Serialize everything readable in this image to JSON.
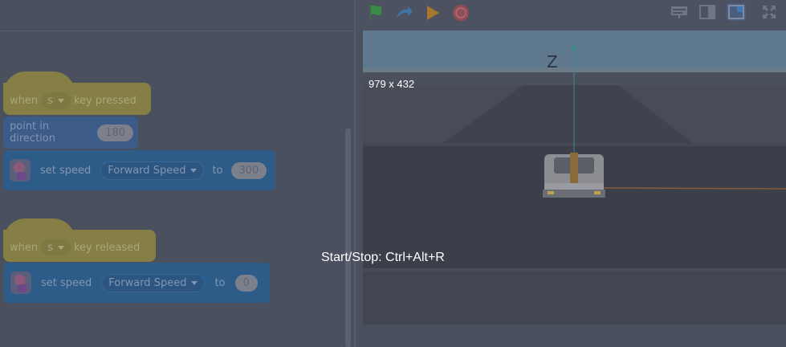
{
  "script": {
    "block1": {
      "hat_when": "when",
      "hat_key": "s",
      "hat_suffix": "key pressed",
      "point_label": "point in direction",
      "point_value": "180",
      "set_label": "set speed",
      "set_param": "Forward Speed",
      "set_to": "to",
      "set_value": "300"
    },
    "block2": {
      "hat_when": "when",
      "hat_key": "s",
      "hat_suffix": "key released",
      "set_label": "set speed",
      "set_param": "Forward Speed",
      "set_to": "to",
      "set_value": "0"
    }
  },
  "toolbar": {
    "icons": [
      "green-flag-icon",
      "turbo-arrow-icon",
      "play-icon",
      "stop-icon"
    ],
    "view_icons": [
      "presentation-icon",
      "small-stage-icon",
      "large-stage-icon",
      "fullscreen-icon"
    ]
  },
  "stage": {
    "axis_label": "Z",
    "size_label": "979 x 432"
  },
  "overlay": {
    "shortcut_text": "Start/Stop: Ctrl+Alt+R"
  },
  "colors": {
    "hat_block": "#857f45",
    "motion_block": "#3d5b88",
    "extension_block": "#2e5c88",
    "overlay_dim": "#4d5262"
  }
}
